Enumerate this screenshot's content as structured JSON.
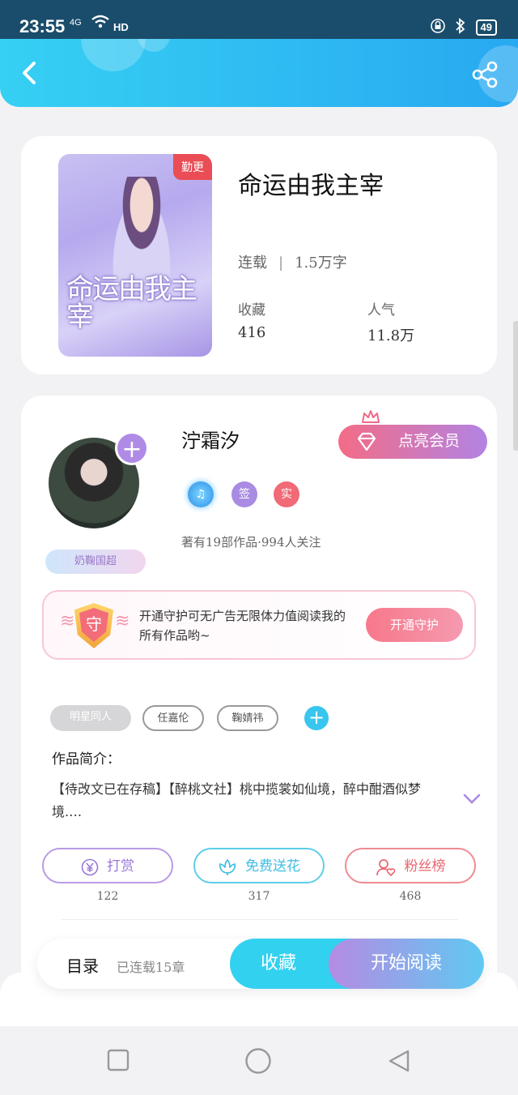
{
  "status": {
    "time": "23:55",
    "network": "4G",
    "hd": "HD",
    "battery": "49"
  },
  "book": {
    "update_badge": "勤更",
    "cover_title": "命运由我主宰",
    "title": "命运由我主宰",
    "status": "连载",
    "word_count": "1.5万字",
    "fav_label": "收藏",
    "fav_value": "416",
    "pop_label": "人气",
    "pop_value": "11.8万"
  },
  "author": {
    "name": "泞霜汐",
    "vip_button": "点亮会员",
    "tag_icons": [
      "♫",
      "签",
      "实"
    ],
    "works_line": "著有19部作品·994人关注",
    "fan_badge": "奶鞠国超"
  },
  "guard": {
    "shield_char": "守",
    "text": "开通守护可无广告无限体力值阅读我的所有作品哟~",
    "button": "开通守护"
  },
  "tags": [
    "明星同人",
    "任嘉伦",
    "鞠婧祎"
  ],
  "intro": {
    "label": "作品简介：",
    "text": "【待改文已在存稿】【醉桃文社】桃中揽裳如仙境，醉中酣酒似梦境.…"
  },
  "actions": [
    {
      "label": "打赏",
      "count": "122",
      "icon": "yuan-icon"
    },
    {
      "label": "免费送花",
      "count": "317",
      "icon": "flower-icon"
    },
    {
      "label": "粉丝榜",
      "count": "468",
      "icon": "fan-icon"
    }
  ],
  "reader": {
    "toc": "目录",
    "toc_sub": "已连载15章",
    "favorite": "收藏",
    "start_reading": "开始阅读"
  },
  "colors": {
    "header": "#2bb8f2",
    "accent_purple": "#b08be6",
    "accent_pink": "#f36c86",
    "accent_cyan": "#33d1f0"
  }
}
